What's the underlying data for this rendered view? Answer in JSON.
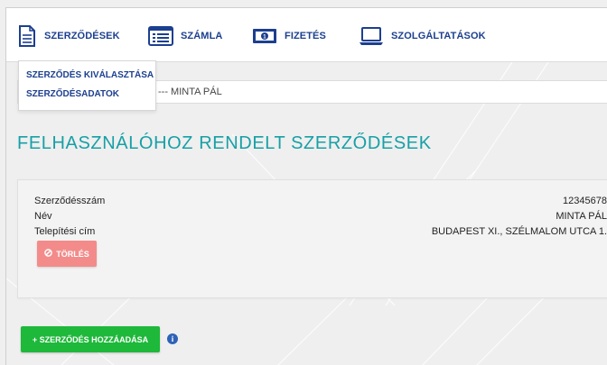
{
  "nav": {
    "items": [
      {
        "label": "SZERZŐDÉSEK",
        "icon": "document-icon"
      },
      {
        "label": "SZÁMLA",
        "icon": "list-icon"
      },
      {
        "label": "FIZETÉS",
        "icon": "banknote-icon"
      },
      {
        "label": "SZOLGÁLTATÁSOK",
        "icon": "laptop-icon"
      }
    ]
  },
  "dropdown": {
    "items": [
      "SZERZŐDÉS KIVÁLASZTÁSA",
      "SZERZŐDÉSADATOK"
    ]
  },
  "selector": {
    "value": "--- MINTA PÁL"
  },
  "page": {
    "title": "FELHASZNÁLÓHOZ RENDELT SZERZŐDÉSEK"
  },
  "contract": {
    "rows": [
      {
        "label": "Szerződésszám",
        "value": "12345678"
      },
      {
        "label": "Név",
        "value": "MINTA PÁL"
      },
      {
        "label": "Telepítési cím",
        "value": "BUDAPEST XI., SZÉLMALOM UTCA 1."
      }
    ],
    "delete_label": "TÖRLÉS"
  },
  "actions": {
    "add_label": "+ SZERZŐDÉS HOZZÁADÁSA",
    "info_glyph": "i"
  },
  "colors": {
    "nav_text": "#1c3f8f",
    "title": "#17a0a6",
    "delete_button": "#f38b8b",
    "add_button": "#1eb83a",
    "info_icon": "#2d62b8"
  }
}
